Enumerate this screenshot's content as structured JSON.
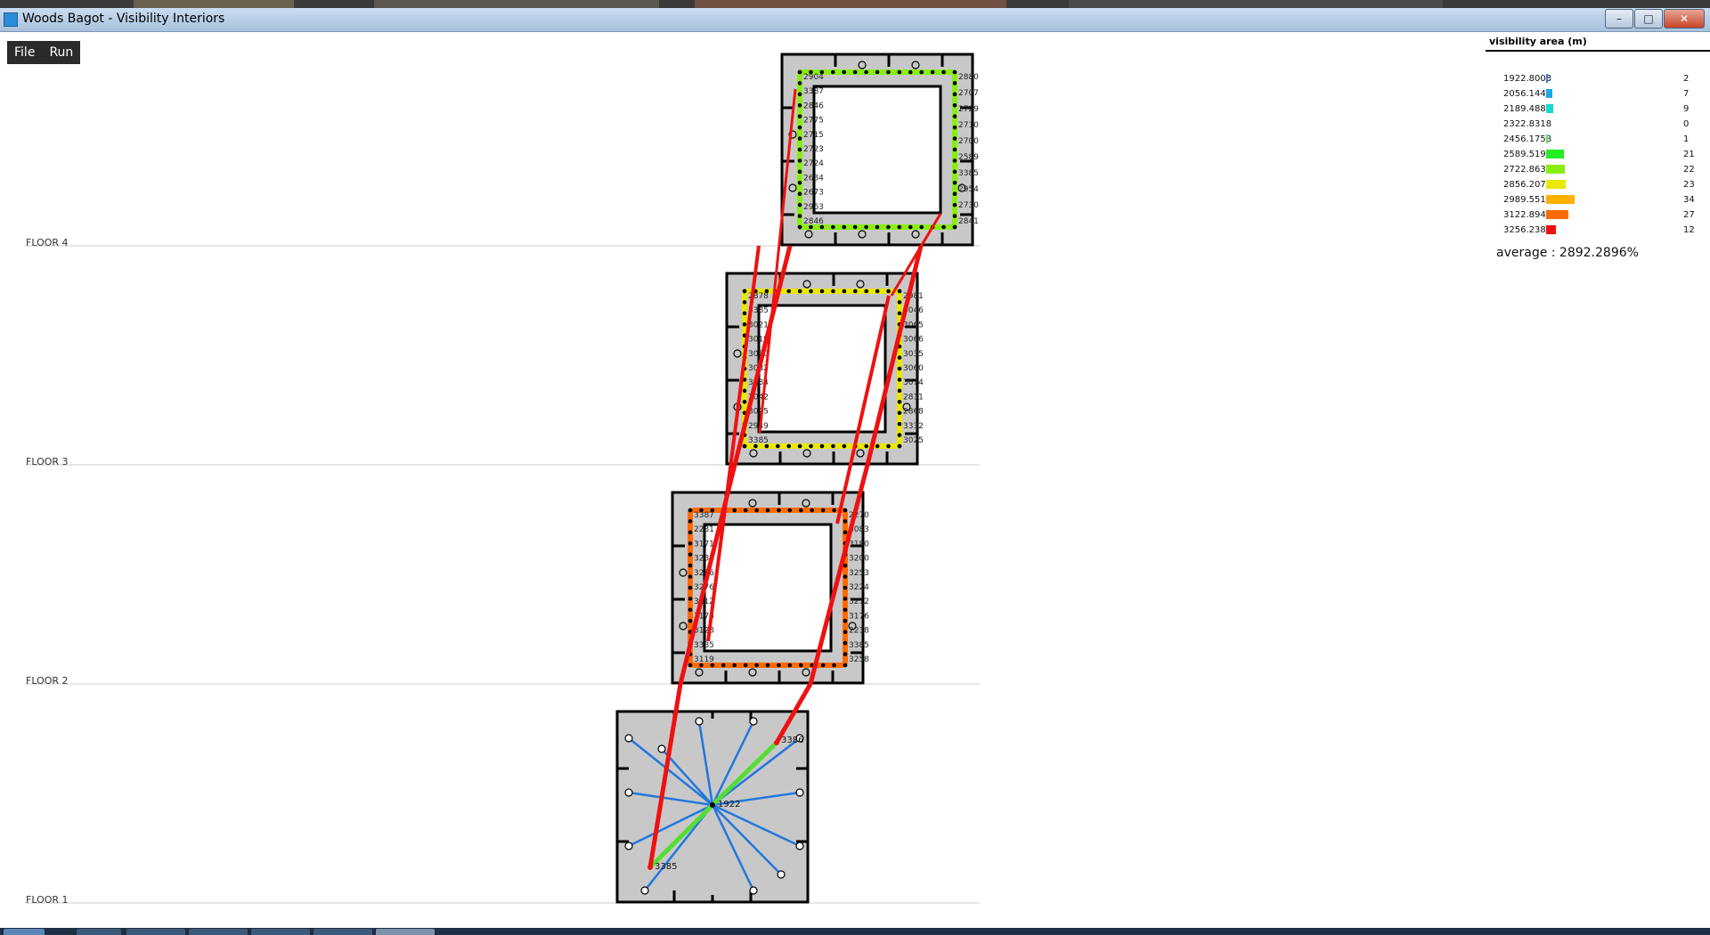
{
  "window": {
    "title": "Woods Bagot - Visibility Interiors",
    "buttons": [
      "minimize",
      "maximize",
      "close"
    ]
  },
  "menu": {
    "items": [
      "File",
      "Run"
    ]
  },
  "floors": [
    "FLOOR 4",
    "FLOOR 3",
    "FLOOR 2",
    "FLOOR 1"
  ],
  "legend": {
    "title": "visibility area (m)",
    "bins": [
      {
        "value": "1922.8003",
        "count": "2",
        "color": "#3a78d8"
      },
      {
        "value": "2056.144",
        "count": "7",
        "color": "#1aa8e8"
      },
      {
        "value": "2189.488",
        "count": "9",
        "color": "#18d8d0"
      },
      {
        "value": "2322.8318",
        "count": "0",
        "color": "#40e090"
      },
      {
        "value": "2456.1758",
        "count": "1",
        "color": "#60e860"
      },
      {
        "value": "2589.5195",
        "count": "21",
        "color": "#22ee22"
      },
      {
        "value": "2722.8633",
        "count": "22",
        "color": "#88ee11"
      },
      {
        "value": "2856.207",
        "count": "23",
        "color": "#e8e800"
      },
      {
        "value": "2989.551",
        "count": "34",
        "color": "#ffb000"
      },
      {
        "value": "3122.8948",
        "count": "27",
        "color": "#ff6a00"
      },
      {
        "value": "3256.2388",
        "count": "12",
        "color": "#ee1111"
      }
    ],
    "average": "average : 2892.2896%"
  },
  "plans": {
    "floor4": {
      "labels": [
        "2904",
        "3387",
        "2846",
        "2775",
        "2715",
        "2723",
        "2724",
        "2684",
        "2673",
        "2963",
        "2846",
        "2880",
        "2707",
        "2729",
        "2710",
        "2700",
        "2589",
        "3385",
        "2954",
        "2730",
        "2841"
      ],
      "color": "#88ee11"
    },
    "floor3": {
      "labels": [
        "2878",
        "3385",
        "3021",
        "3019",
        "3050",
        "3082",
        "3084",
        "3042",
        "3025",
        "2949",
        "3385",
        "2981",
        "3046",
        "3065",
        "3066",
        "3035",
        "3060",
        "3074",
        "2831",
        "2868",
        "3332",
        "3025"
      ],
      "color": "#e8e800"
    },
    "floor2": {
      "labels": [
        "3387",
        "2231",
        "3171",
        "3232",
        "3286",
        "3276",
        "3212",
        "3176",
        "3128",
        "3385",
        "3119",
        "2270",
        "3083",
        "3180",
        "3200",
        "3253",
        "3224",
        "3212",
        "3176",
        "2238",
        "3385",
        "3258"
      ],
      "color": "#ff6a00"
    },
    "floor1": {
      "labels": [
        "1922",
        "3385",
        "3386"
      ],
      "color": "#22ee22"
    }
  }
}
